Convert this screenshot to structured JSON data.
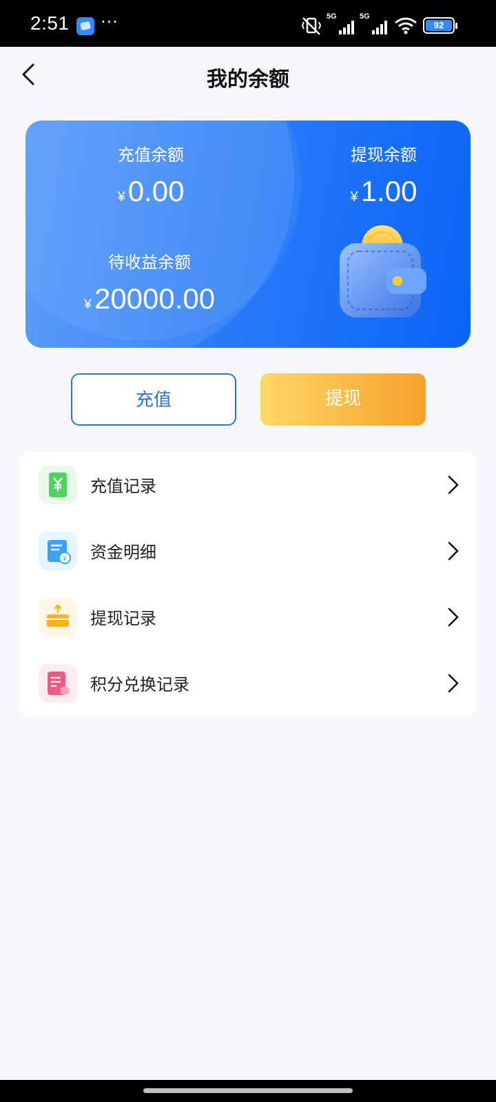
{
  "status_bar": {
    "time": "2:51",
    "more": "···",
    "battery": "92",
    "network": "5G"
  },
  "header": {
    "title": "我的余额",
    "back_icon": "chevron-left-icon"
  },
  "balance_card": {
    "currency": "¥",
    "recharge": {
      "label": "充值余额",
      "amount": "0.00"
    },
    "withdraw": {
      "label": "提现余额",
      "amount": "1.00"
    },
    "pending": {
      "label": "待收益余额",
      "amount": "20000.00"
    },
    "illustration": "wallet-icon",
    "gradient": [
      "#4d94fb",
      "#0a64f6"
    ]
  },
  "actions": {
    "recharge_label": "充值",
    "withdraw_label": "提现",
    "recharge_color": "#2a72d8",
    "withdraw_gradient": [
      "#ffd766",
      "#f6a12c"
    ]
  },
  "menu": {
    "items": [
      {
        "label": "充值记录",
        "icon": "recharge-record-icon",
        "color": "#4fd462"
      },
      {
        "label": "资金明细",
        "icon": "fund-detail-icon",
        "color": "#3aa3f5"
      },
      {
        "label": "提现记录",
        "icon": "withdraw-record-icon",
        "color": "#ffb21d"
      },
      {
        "label": "积分兑换记录",
        "icon": "points-exchange-icon",
        "color": "#f35a83"
      }
    ]
  }
}
